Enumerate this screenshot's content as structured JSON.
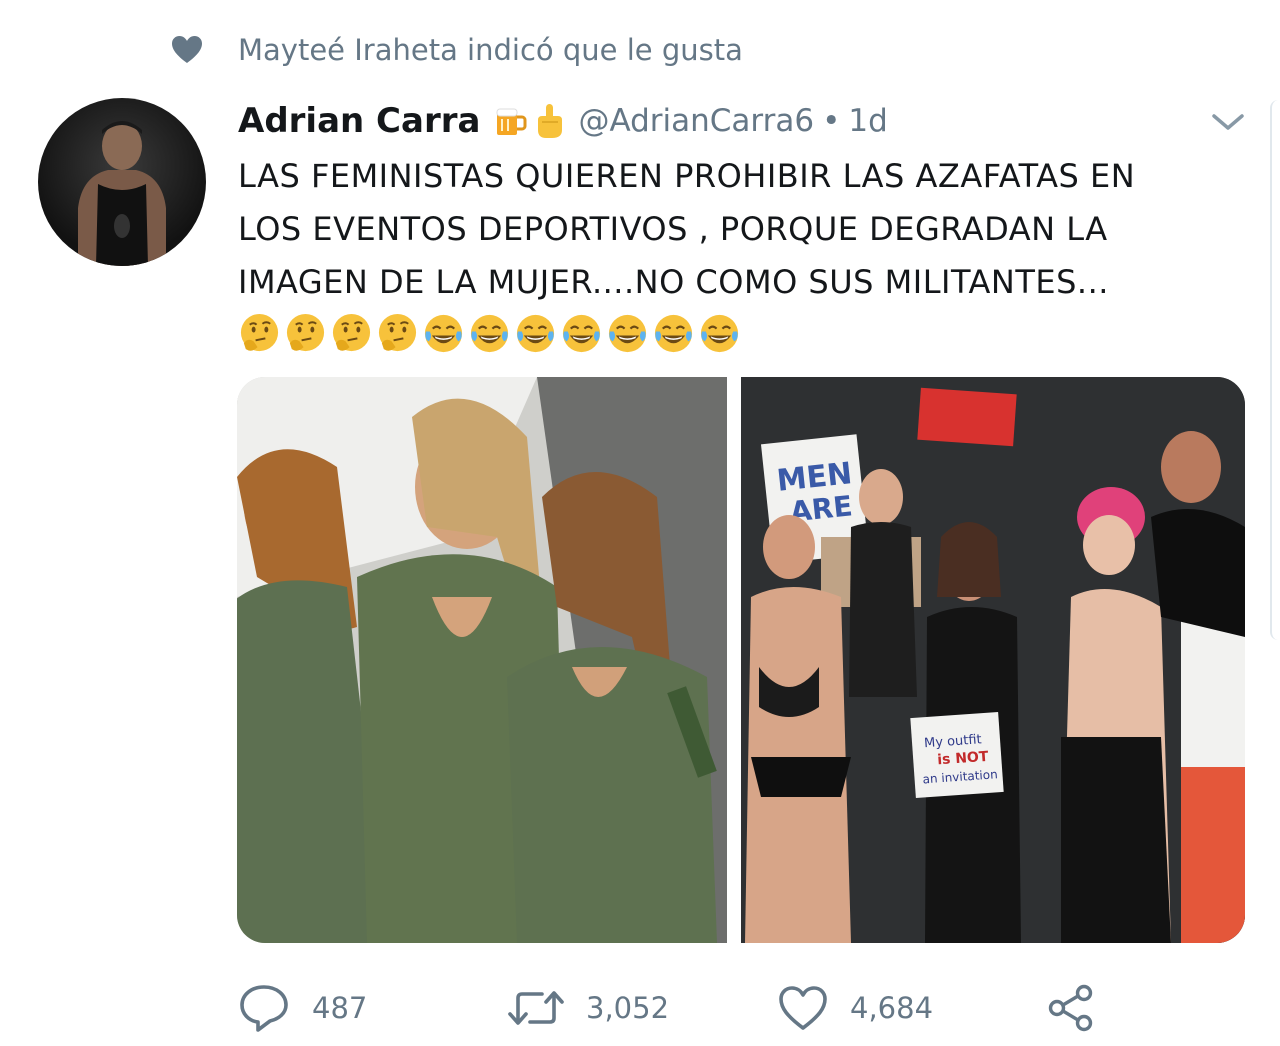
{
  "context": {
    "icon": "heart-icon",
    "text": "Mayteé Iraheta indicó que le gusta"
  },
  "tweet": {
    "author_name": "Adrian Carra",
    "name_emojis": [
      "beer-mug-emoji",
      "middle-finger-emoji"
    ],
    "handle": "@AdrianCarra6",
    "separator": "•",
    "time": "1d",
    "text": "LAS FEMINISTAS QUIEREN PROHIBIR LAS AZAFATAS EN\nLOS EVENTOS DEPORTIVOS , PORQUE DEGRADAN LA\nIMAGEN DE LA MUJER....NO COMO SUS MILITANTES...",
    "emojis": [
      "thinking-face",
      "thinking-face",
      "thinking-face",
      "thinking-face",
      "tears-of-joy",
      "tears-of-joy",
      "tears-of-joy",
      "tears-of-joy",
      "tears-of-joy",
      "tears-of-joy",
      "tears-of-joy"
    ],
    "media": {
      "left_image": "promo-models-photo",
      "right_image": "protest-photo",
      "sign_texts": [
        "MEN",
        "ARE",
        "My outfit is NOT an invitation"
      ]
    }
  },
  "actions": {
    "reply": {
      "icon": "reply-icon",
      "count": "487"
    },
    "retweet": {
      "icon": "retweet-icon",
      "count": "3,052"
    },
    "like": {
      "icon": "heart-outline-icon",
      "count": "4,684"
    },
    "share": {
      "icon": "share-icon"
    }
  },
  "colors": {
    "secondary_text": "#657786",
    "primary_text": "#14171a",
    "emoji_yellow": "#f7c23b"
  }
}
